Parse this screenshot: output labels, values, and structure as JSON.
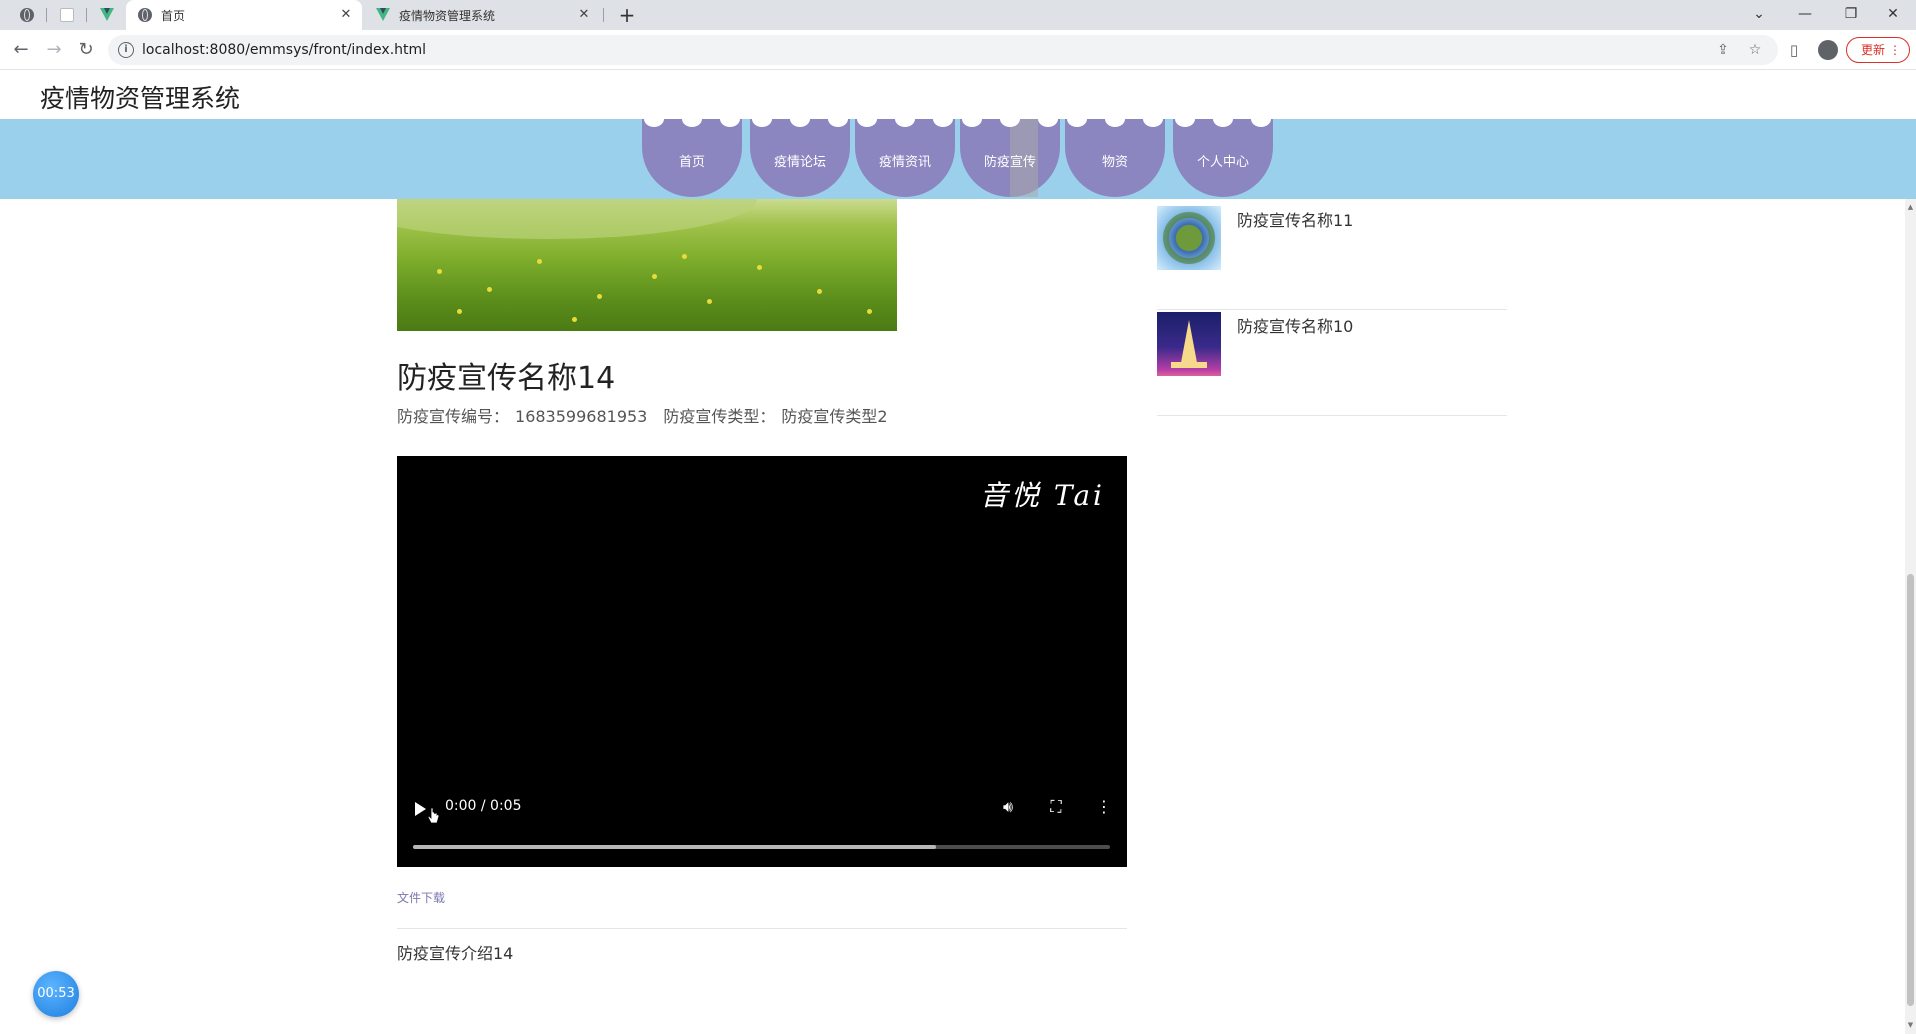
{
  "browser": {
    "tabs": [
      {
        "label": "",
        "icon": "globe-icon"
      },
      {
        "label": "",
        "icon": "blank-page-icon"
      },
      {
        "label": "",
        "icon": "vue-logo-icon"
      },
      {
        "label": "首页",
        "icon": "globe-icon",
        "active": true
      },
      {
        "label": "疫情物资管理系统",
        "icon": "vue-logo-icon"
      }
    ],
    "address": "localhost:8080/emmsys/front/index.html",
    "update_label": "更新"
  },
  "site": {
    "title": "疫情物资管理系统",
    "nav": [
      {
        "label": "首页"
      },
      {
        "label": "疫情论坛"
      },
      {
        "label": "疫情资讯"
      },
      {
        "label": "防疫宣传",
        "active": true
      },
      {
        "label": "物资"
      },
      {
        "label": "个人中心"
      }
    ]
  },
  "article": {
    "title": "防疫宣传名称14",
    "id_label": "防疫宣传编号：",
    "id_value": "1683599681953",
    "type_label": "防疫宣传类型：",
    "type_value": "防疫宣传类型2",
    "video": {
      "watermark": "音悦 Tai",
      "time": "0:00 / 0:05",
      "buffered_fraction": 0.75
    },
    "download_label": "文件下载",
    "intro": "防疫宣传介绍14"
  },
  "sidebar": {
    "items": [
      {
        "name": "防疫宣传名称11",
        "thumb": "planet-photo"
      },
      {
        "name": "防疫宣传名称10",
        "thumb": "eiffel-tower-photo"
      }
    ]
  },
  "timer": {
    "label": "00:53"
  },
  "colors": {
    "navbar_bg": "#9bd0ec",
    "nav_item_bg": "#8b86c0",
    "link": "#7b78b0",
    "update": "#d93025"
  }
}
